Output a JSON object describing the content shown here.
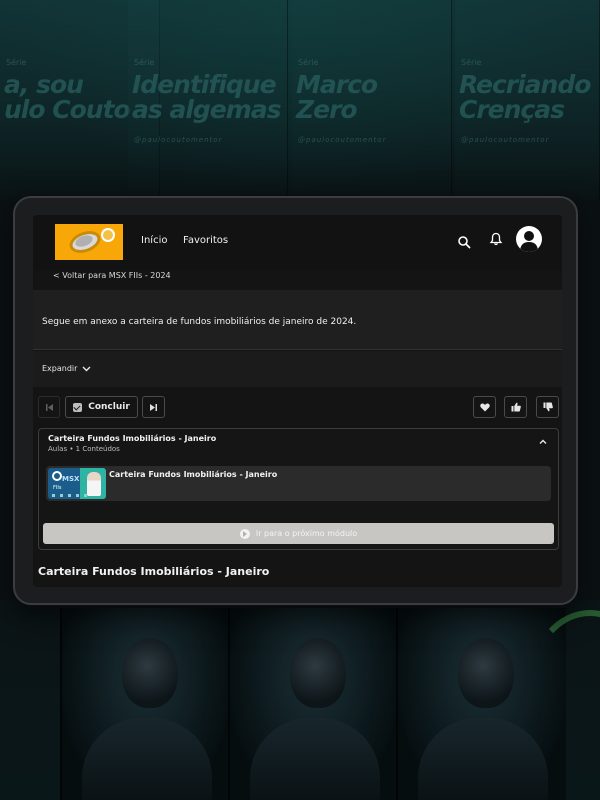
{
  "background": {
    "posters": [
      {
        "kicker": "Série",
        "title_line1": "a, sou",
        "title_line2": "ulo Couto",
        "handle": ""
      },
      {
        "kicker": "Série",
        "title_line1": "Identifique",
        "title_line2": "as algemas",
        "handle": "@paulocoutomentor"
      },
      {
        "kicker": "Série",
        "title_line1": "Marco",
        "title_line2": "Zero",
        "handle": "@paulocoutomentor"
      },
      {
        "kicker": "Série",
        "title_line1": "Recriando",
        "title_line2": "Crenças",
        "handle": "@paulocoutomentor"
      }
    ]
  },
  "header": {
    "logo_name": "msx-fiis-logo",
    "nav": [
      "Início",
      "Favoritos"
    ],
    "icons": [
      "search-icon",
      "bell-icon",
      "user-avatar"
    ]
  },
  "back_link": "< Voltar para MSX FIIs - 2024",
  "description": "Segue em anexo a carteira de fundos imobiliários de janeiro de 2024.",
  "expand_label": "Expandir",
  "controls": {
    "prev_icon": "skip-previous-icon",
    "concluir_label": "Concluir",
    "next_icon": "skip-next-icon",
    "favorite_icon": "heart-icon",
    "like_icon": "thumbs-up-icon",
    "dislike_icon": "thumbs-down-icon"
  },
  "module": {
    "title": "Carteira Fundos Imobiliários - Janeiro",
    "subtitle": "Aulas • 1 Conteúdos",
    "lessons": [
      {
        "title": "Carteira Fundos Imobiliários - Janeiro",
        "thumb_brand": "MSX",
        "thumb_sub": "FIIs"
      }
    ],
    "next_module_label": "Ir para o próximo módulo"
  },
  "content_title": "Carteira Fundos Imobiliários - Janeiro",
  "colors": {
    "accent_logo": "#f7a707",
    "screen_bg": "#141414",
    "next_button_bg": "#c8c6c3"
  }
}
